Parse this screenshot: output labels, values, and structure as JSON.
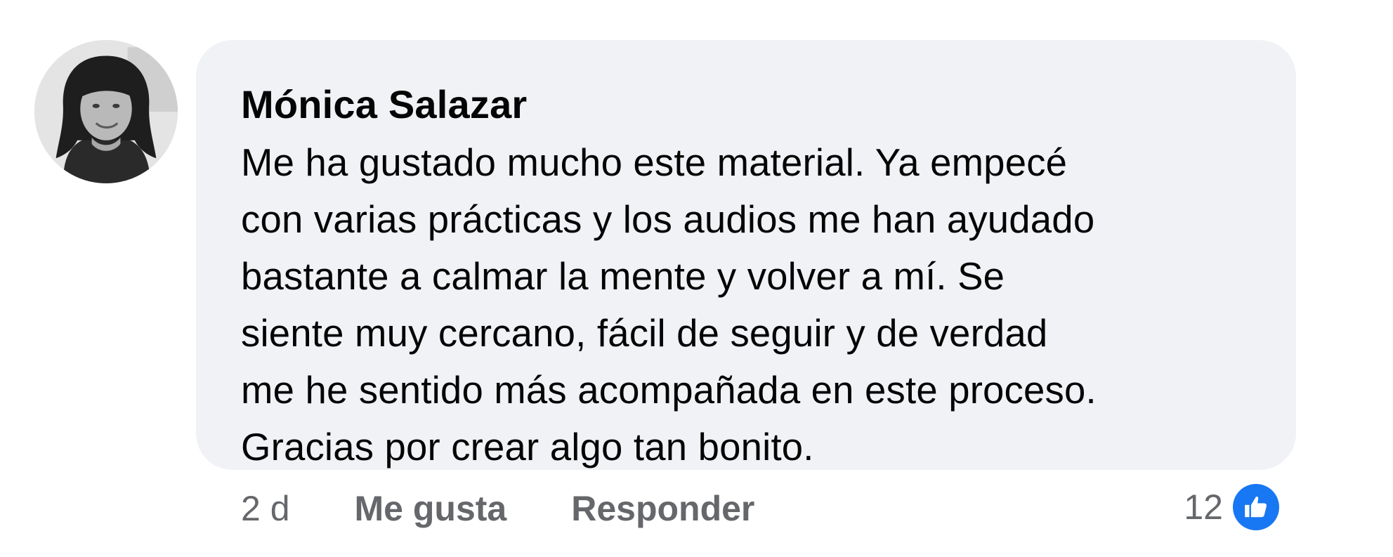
{
  "comment": {
    "author": "Mónica Salazar",
    "text": "Me ha gustado mucho este material. Ya empecé\ncon varias prácticas y los audios me han ayudado\nbastante a calmar la mente y volver a mí. Se\nsiente muy cercano, fácil de seguir y de verdad\nme he sentido más acompañada en este proceso.\nGracias por crear algo tan bonito."
  },
  "actions": {
    "time": "2 d",
    "like_label": "Me gusta",
    "reply_label": "Responder"
  },
  "reactions": {
    "count": "12",
    "icon": "thumbs-up-icon",
    "color": "#1877f2"
  },
  "colors": {
    "bubble": "#f0f2f5",
    "text": "#050505",
    "secondary_text": "#65676b"
  }
}
